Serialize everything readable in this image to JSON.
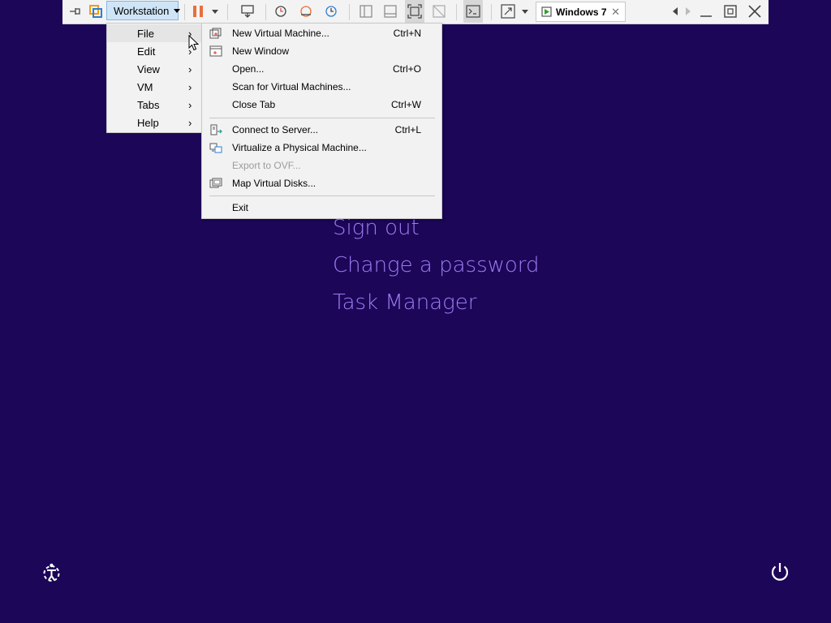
{
  "toolbar": {
    "workstation_label": "Workstation",
    "tab_label": "Windows 7",
    "tab_close": "✕"
  },
  "menu": {
    "items": [
      {
        "label": "File",
        "arrow": "›"
      },
      {
        "label": "Edit",
        "arrow": "›"
      },
      {
        "label": "View",
        "arrow": "›"
      },
      {
        "label": "VM",
        "arrow": "›"
      },
      {
        "label": "Tabs",
        "arrow": "›"
      },
      {
        "label": "Help",
        "arrow": "›"
      }
    ]
  },
  "file_menu": {
    "items": [
      {
        "label": "New Virtual Machine...",
        "shortcut": "Ctrl+N",
        "icon": "new-vm-icon"
      },
      {
        "label": "New Window",
        "shortcut": "",
        "icon": "new-window-icon"
      },
      {
        "label": "Open...",
        "shortcut": "Ctrl+O",
        "icon": ""
      },
      {
        "label": "Scan for Virtual Machines...",
        "shortcut": "",
        "icon": ""
      },
      {
        "label": "Close Tab",
        "shortcut": "Ctrl+W",
        "icon": ""
      },
      {
        "label": "Connect to Server...",
        "shortcut": "Ctrl+L",
        "icon": "connect-server-icon"
      },
      {
        "label": "Virtualize a Physical Machine...",
        "shortcut": "",
        "icon": "virtualize-icon"
      },
      {
        "label": "Export to OVF...",
        "shortcut": "",
        "icon": "",
        "disabled": true
      },
      {
        "label": "Map Virtual Disks...",
        "shortcut": "",
        "icon": "map-disks-icon"
      },
      {
        "label": "Exit",
        "shortcut": "",
        "icon": ""
      }
    ]
  },
  "lock_screen": {
    "options": [
      "Sign out",
      "Change a password",
      "Task Manager"
    ]
  },
  "colors": {
    "background": "#1c0658",
    "option_text": "#9c7cf0",
    "pause": "#e8703a"
  }
}
